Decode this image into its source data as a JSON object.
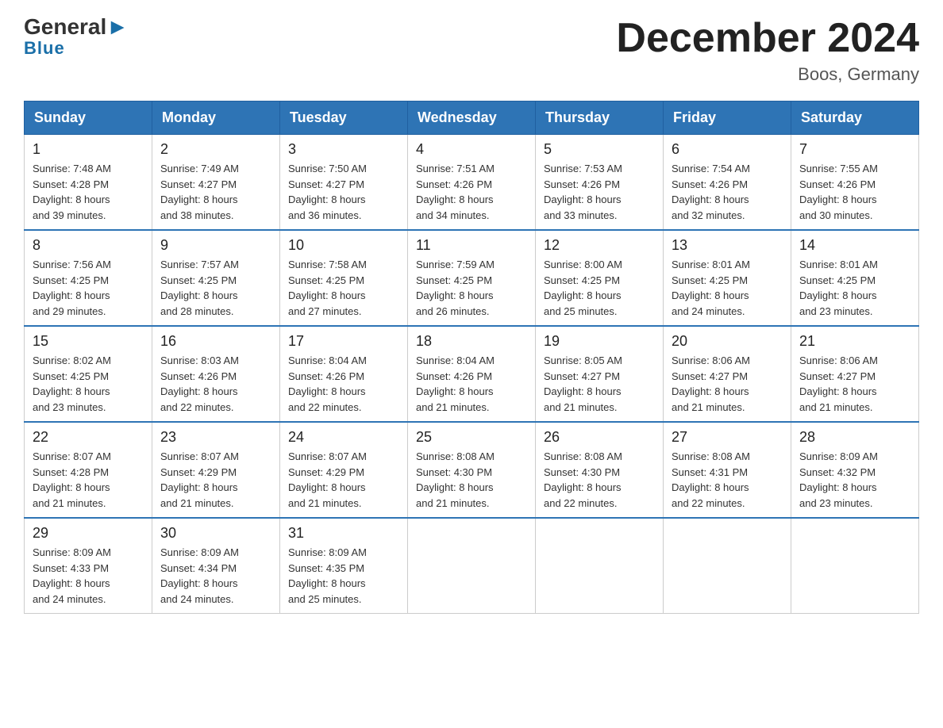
{
  "logo": {
    "general": "General",
    "arrow": "▶",
    "blue": "Blue"
  },
  "title": "December 2024",
  "subtitle": "Boos, Germany",
  "days_of_week": [
    "Sunday",
    "Monday",
    "Tuesday",
    "Wednesday",
    "Thursday",
    "Friday",
    "Saturday"
  ],
  "weeks": [
    [
      {
        "day": "1",
        "sunrise": "7:48 AM",
        "sunset": "4:28 PM",
        "daylight": "8 hours and 39 minutes."
      },
      {
        "day": "2",
        "sunrise": "7:49 AM",
        "sunset": "4:27 PM",
        "daylight": "8 hours and 38 minutes."
      },
      {
        "day": "3",
        "sunrise": "7:50 AM",
        "sunset": "4:27 PM",
        "daylight": "8 hours and 36 minutes."
      },
      {
        "day": "4",
        "sunrise": "7:51 AM",
        "sunset": "4:26 PM",
        "daylight": "8 hours and 34 minutes."
      },
      {
        "day": "5",
        "sunrise": "7:53 AM",
        "sunset": "4:26 PM",
        "daylight": "8 hours and 33 minutes."
      },
      {
        "day": "6",
        "sunrise": "7:54 AM",
        "sunset": "4:26 PM",
        "daylight": "8 hours and 32 minutes."
      },
      {
        "day": "7",
        "sunrise": "7:55 AM",
        "sunset": "4:26 PM",
        "daylight": "8 hours and 30 minutes."
      }
    ],
    [
      {
        "day": "8",
        "sunrise": "7:56 AM",
        "sunset": "4:25 PM",
        "daylight": "8 hours and 29 minutes."
      },
      {
        "day": "9",
        "sunrise": "7:57 AM",
        "sunset": "4:25 PM",
        "daylight": "8 hours and 28 minutes."
      },
      {
        "day": "10",
        "sunrise": "7:58 AM",
        "sunset": "4:25 PM",
        "daylight": "8 hours and 27 minutes."
      },
      {
        "day": "11",
        "sunrise": "7:59 AM",
        "sunset": "4:25 PM",
        "daylight": "8 hours and 26 minutes."
      },
      {
        "day": "12",
        "sunrise": "8:00 AM",
        "sunset": "4:25 PM",
        "daylight": "8 hours and 25 minutes."
      },
      {
        "day": "13",
        "sunrise": "8:01 AM",
        "sunset": "4:25 PM",
        "daylight": "8 hours and 24 minutes."
      },
      {
        "day": "14",
        "sunrise": "8:01 AM",
        "sunset": "4:25 PM",
        "daylight": "8 hours and 23 minutes."
      }
    ],
    [
      {
        "day": "15",
        "sunrise": "8:02 AM",
        "sunset": "4:25 PM",
        "daylight": "8 hours and 23 minutes."
      },
      {
        "day": "16",
        "sunrise": "8:03 AM",
        "sunset": "4:26 PM",
        "daylight": "8 hours and 22 minutes."
      },
      {
        "day": "17",
        "sunrise": "8:04 AM",
        "sunset": "4:26 PM",
        "daylight": "8 hours and 22 minutes."
      },
      {
        "day": "18",
        "sunrise": "8:04 AM",
        "sunset": "4:26 PM",
        "daylight": "8 hours and 21 minutes."
      },
      {
        "day": "19",
        "sunrise": "8:05 AM",
        "sunset": "4:27 PM",
        "daylight": "8 hours and 21 minutes."
      },
      {
        "day": "20",
        "sunrise": "8:06 AM",
        "sunset": "4:27 PM",
        "daylight": "8 hours and 21 minutes."
      },
      {
        "day": "21",
        "sunrise": "8:06 AM",
        "sunset": "4:27 PM",
        "daylight": "8 hours and 21 minutes."
      }
    ],
    [
      {
        "day": "22",
        "sunrise": "8:07 AM",
        "sunset": "4:28 PM",
        "daylight": "8 hours and 21 minutes."
      },
      {
        "day": "23",
        "sunrise": "8:07 AM",
        "sunset": "4:29 PM",
        "daylight": "8 hours and 21 minutes."
      },
      {
        "day": "24",
        "sunrise": "8:07 AM",
        "sunset": "4:29 PM",
        "daylight": "8 hours and 21 minutes."
      },
      {
        "day": "25",
        "sunrise": "8:08 AM",
        "sunset": "4:30 PM",
        "daylight": "8 hours and 21 minutes."
      },
      {
        "day": "26",
        "sunrise": "8:08 AM",
        "sunset": "4:30 PM",
        "daylight": "8 hours and 22 minutes."
      },
      {
        "day": "27",
        "sunrise": "8:08 AM",
        "sunset": "4:31 PM",
        "daylight": "8 hours and 22 minutes."
      },
      {
        "day": "28",
        "sunrise": "8:09 AM",
        "sunset": "4:32 PM",
        "daylight": "8 hours and 23 minutes."
      }
    ],
    [
      {
        "day": "29",
        "sunrise": "8:09 AM",
        "sunset": "4:33 PM",
        "daylight": "8 hours and 24 minutes."
      },
      {
        "day": "30",
        "sunrise": "8:09 AM",
        "sunset": "4:34 PM",
        "daylight": "8 hours and 24 minutes."
      },
      {
        "day": "31",
        "sunrise": "8:09 AM",
        "sunset": "4:35 PM",
        "daylight": "8 hours and 25 minutes."
      },
      null,
      null,
      null,
      null
    ]
  ],
  "cell_labels": {
    "sunrise": "Sunrise: ",
    "sunset": "Sunset: ",
    "daylight": "Daylight: "
  }
}
